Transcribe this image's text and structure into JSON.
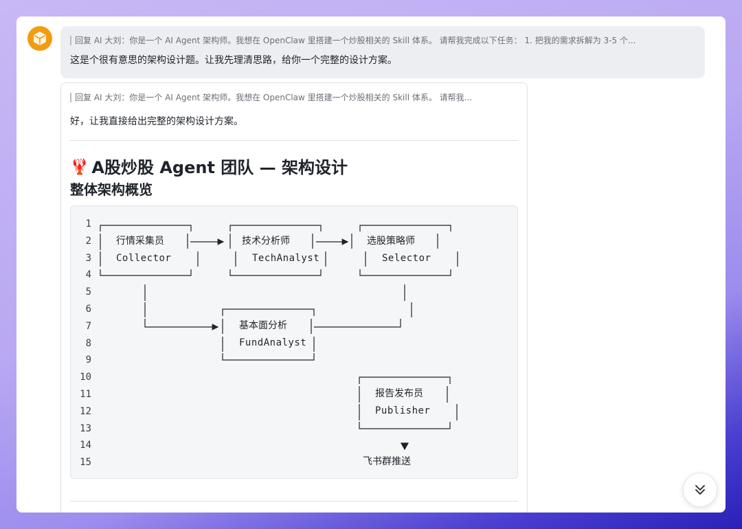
{
  "first_message": {
    "quote": "回复 AI 大刘：你是一个 AI Agent 架构师。我想在 OpenClaw 里搭建一个炒股相关的 Skill 体系。 请帮我完成以下任务： 1. 把我的需求拆解为 3-5 个...",
    "reply": "这是个很有意思的架构设计题。让我先理清思路，给你一个完整的设计方案。"
  },
  "second_message": {
    "quote": "回复 AI 大刘：你是一个 AI Agent 架构师。我想在 OpenClaw 里搭建一个炒股相关的 Skill 体系。 请帮我...",
    "reply": "好，让我直接给出完整的架构设计方案。",
    "heading": "A股炒股 Agent 团队 — 架构设计",
    "heading_icon": "🦞",
    "subheading": "整体架构概览"
  },
  "code": {
    "line_numbers": [
      "1",
      "2",
      "3",
      "4",
      "5",
      "6",
      "7",
      "8",
      "9",
      "10",
      "11",
      "12",
      "13",
      "14",
      "15"
    ],
    "nodes": {
      "collector": {
        "cn": "行情采集员",
        "en": "Collector"
      },
      "tech": {
        "cn": "技术分析师",
        "en": "TechAnalyst"
      },
      "selector": {
        "cn": "选股策略师",
        "en": "Selector"
      },
      "fund": {
        "cn": "基本面分析",
        "en": "FundAnalyst"
      },
      "publisher": {
        "cn": "报告发布员",
        "en": "Publisher"
      }
    },
    "output_label": "飞书群推送"
  },
  "icons": {
    "avatar": "cube-icon",
    "scroll": "double-chevron-down-icon"
  },
  "colors": {
    "avatar_bg": "#f39c12",
    "bubble_bg": "#eceef1",
    "code_bg": "#f5f6f7"
  }
}
